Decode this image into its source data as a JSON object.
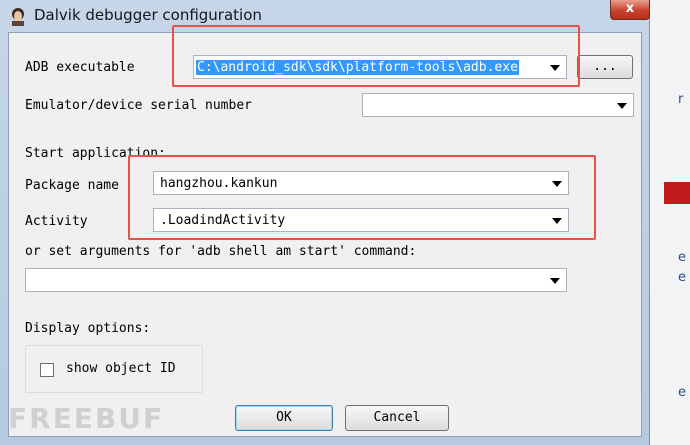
{
  "window": {
    "title": "Dalvik debugger configuration",
    "close_label": "x"
  },
  "adb": {
    "label": "ADB executable",
    "value": "C:\\android_sdk\\sdk\\platform-tools\\adb.exe",
    "browse_label": "..."
  },
  "serial": {
    "label": "Emulator/device serial number",
    "value": ""
  },
  "start_app": {
    "heading": "Start application:",
    "package_label": "Package name",
    "package_value": "hangzhou.kankun",
    "activity_label": "Activity",
    "activity_value": ".LoadindActivity",
    "args_label": "or set arguments for 'adb shell am start' command:",
    "args_value": ""
  },
  "display": {
    "heading": "Display options:",
    "show_object_id_label": "show object ID",
    "show_object_id_checked": false
  },
  "buttons": {
    "ok": "OK",
    "cancel": "Cancel"
  },
  "watermark": "FREEBUF",
  "background": {
    "edge_chars": [
      "r",
      "e",
      "e",
      "e"
    ]
  },
  "colors": {
    "highlight": "#e8504a",
    "selection": "#3399ff"
  }
}
